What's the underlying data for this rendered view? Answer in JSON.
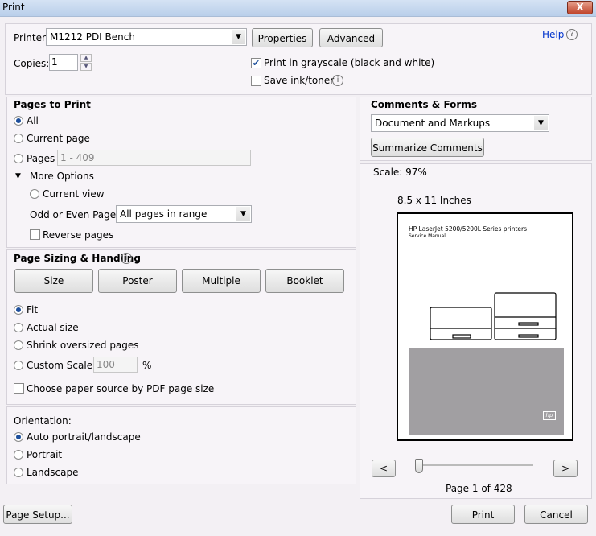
{
  "window": {
    "title": "Print",
    "close": "X"
  },
  "top": {
    "printer_label": "Printer:",
    "printer_value": "M1212 PDI Bench",
    "properties": "Properties",
    "advanced": "Advanced",
    "help": "Help",
    "copies_label": "Copies:",
    "copies_value": "1",
    "grayscale_label": "Print in grayscale (black and white)",
    "grayscale_checked": true,
    "save_ink_label": "Save ink/toner",
    "save_ink_checked": false
  },
  "pages": {
    "title": "Pages to Print",
    "all": "All",
    "current": "Current page",
    "pages": "Pages",
    "pages_value": "1 - 409",
    "more": "More Options",
    "current_view": "Current view",
    "odd_even_label": "Odd or Even Pages:",
    "odd_even_value": "All pages in range",
    "reverse": "Reverse pages",
    "selected": "All"
  },
  "sizing": {
    "title": "Page Sizing & Handling",
    "buttons": [
      "Size",
      "Poster",
      "Multiple",
      "Booklet"
    ],
    "fit": "Fit",
    "actual": "Actual size",
    "shrink": "Shrink oversized pages",
    "custom": "Custom Scale:",
    "custom_value": "100",
    "percent": "%",
    "paper_source": "Choose paper source by PDF page size",
    "selected": "Fit"
  },
  "orientation": {
    "title": "Orientation:",
    "auto": "Auto portrait/landscape",
    "portrait": "Portrait",
    "landscape": "Landscape",
    "selected": "Auto portrait/landscape"
  },
  "comments": {
    "title": "Comments & Forms",
    "value": "Document and Markups",
    "summarize": "Summarize Comments"
  },
  "preview": {
    "scale": "Scale:  97%",
    "paper": "8.5 x 11 Inches",
    "doc_title": "HP LaserJet 5200/5200L Series printers",
    "doc_subtitle": "Service Manual",
    "logo": "hp",
    "prev": "<",
    "next": ">",
    "page_info": "Page 1 of 428",
    "current_page": 1,
    "total_pages": 428
  },
  "footer": {
    "page_setup": "Page Setup...",
    "print": "Print",
    "cancel": "Cancel"
  }
}
